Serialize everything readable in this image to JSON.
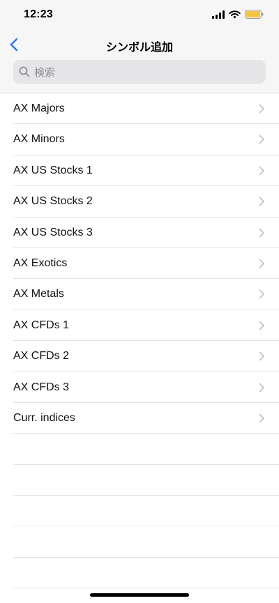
{
  "status_bar": {
    "time": "12:23",
    "icons": [
      "signal-icon",
      "wifi-icon",
      "battery-icon"
    ],
    "battery_color": "#f5c542"
  },
  "nav": {
    "back_icon": "chevron-left-icon",
    "title": "シンボル追加",
    "accent_color": "#2f7cf6"
  },
  "search": {
    "placeholder": "検索",
    "icon": "search-icon"
  },
  "list": {
    "items": [
      {
        "label": "AX Majors"
      },
      {
        "label": "AX Minors"
      },
      {
        "label": "AX US Stocks 1"
      },
      {
        "label": "AX US Stocks 2"
      },
      {
        "label": "AX US Stocks 3"
      },
      {
        "label": "AX Exotics"
      },
      {
        "label": "AX Metals"
      },
      {
        "label": "AX CFDs 1"
      },
      {
        "label": "AX CFDs 2"
      },
      {
        "label": "AX CFDs 3"
      },
      {
        "label": "Curr. indices"
      }
    ],
    "empty_rows": 5
  }
}
